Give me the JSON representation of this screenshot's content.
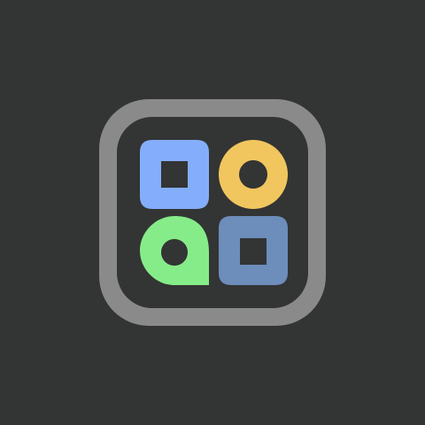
{
  "background": "#333434",
  "app_icon": {
    "icon_name": "app-grid-icon",
    "frame_color": "#8a8a8a",
    "inner_color": "#333434",
    "tiles": [
      {
        "name": "square-tile",
        "shape": "rounded-square-with-square-hole",
        "color": "#84aefb"
      },
      {
        "name": "circle-tile",
        "shape": "ring",
        "color": "#f1c65e"
      },
      {
        "name": "droplet-tile",
        "shape": "teardrop-with-hole",
        "color": "#86ec89"
      },
      {
        "name": "dark-square-tile",
        "shape": "rounded-square-with-square-hole",
        "color": "#6d8dbb"
      }
    ]
  }
}
